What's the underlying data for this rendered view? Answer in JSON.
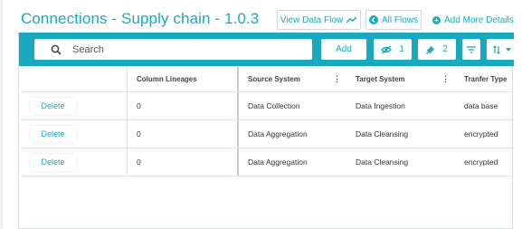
{
  "header": {
    "title": "Connections - Supply chain - 1.0.3",
    "view_data_flow": "View Data Flow",
    "all_flows": "All Flows",
    "add_more_details": "Add More Details"
  },
  "toolbar": {
    "search_placeholder": "Search",
    "add_label": "Add",
    "hidden_count": "1",
    "pinned_count": "2"
  },
  "table": {
    "columns": [
      "",
      "Column Lineages",
      "Source System",
      "Target System",
      "Tranfer Type"
    ],
    "rows": [
      {
        "action": "Delete",
        "lineages": "0",
        "source": "Data Collection",
        "target": "Data Ingestion",
        "type": "data base"
      },
      {
        "action": "Delete",
        "lineages": "0",
        "source": "Data Aggregation",
        "target": "Data Cleansing",
        "type": "encrypted"
      },
      {
        "action": "Delete",
        "lineages": "0",
        "source": "Data Aggregation",
        "target": "Data Cleansing",
        "type": "encrypted"
      }
    ]
  },
  "colors": {
    "accent": "#1aa8be",
    "border": "#e4e4e4"
  }
}
